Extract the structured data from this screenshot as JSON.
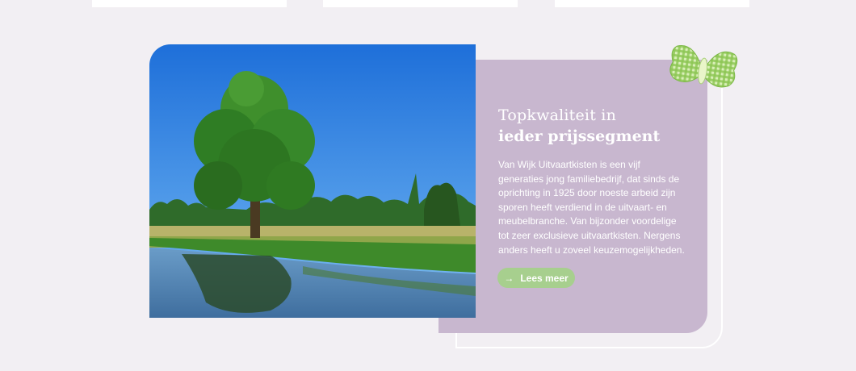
{
  "feature": {
    "heading_line1": "Topkwaliteit in",
    "heading_line2": "ieder prijssegment",
    "body": "Van Wijk Uitvaartkisten is een vijf generaties jong familiebedrijf, dat sinds de oprichting in 1925 door noeste arbeid zijn sporen heeft verdiend in de uitvaart- en meubelbranche. Van bijzonder voordelige tot zeer exclusieve uitvaartkisten. Nergens anders heeft u zoveel keuzemogelijkheden.",
    "cta_label": "Lees meer",
    "cta_icon": "arrow-right-icon",
    "decoration_icon": "butterfly-icon"
  },
  "colors": {
    "page_bg": "#f2eff3",
    "panel": "#c8b7cf",
    "cta": "#a7cf8e",
    "text": "#ffffff"
  }
}
